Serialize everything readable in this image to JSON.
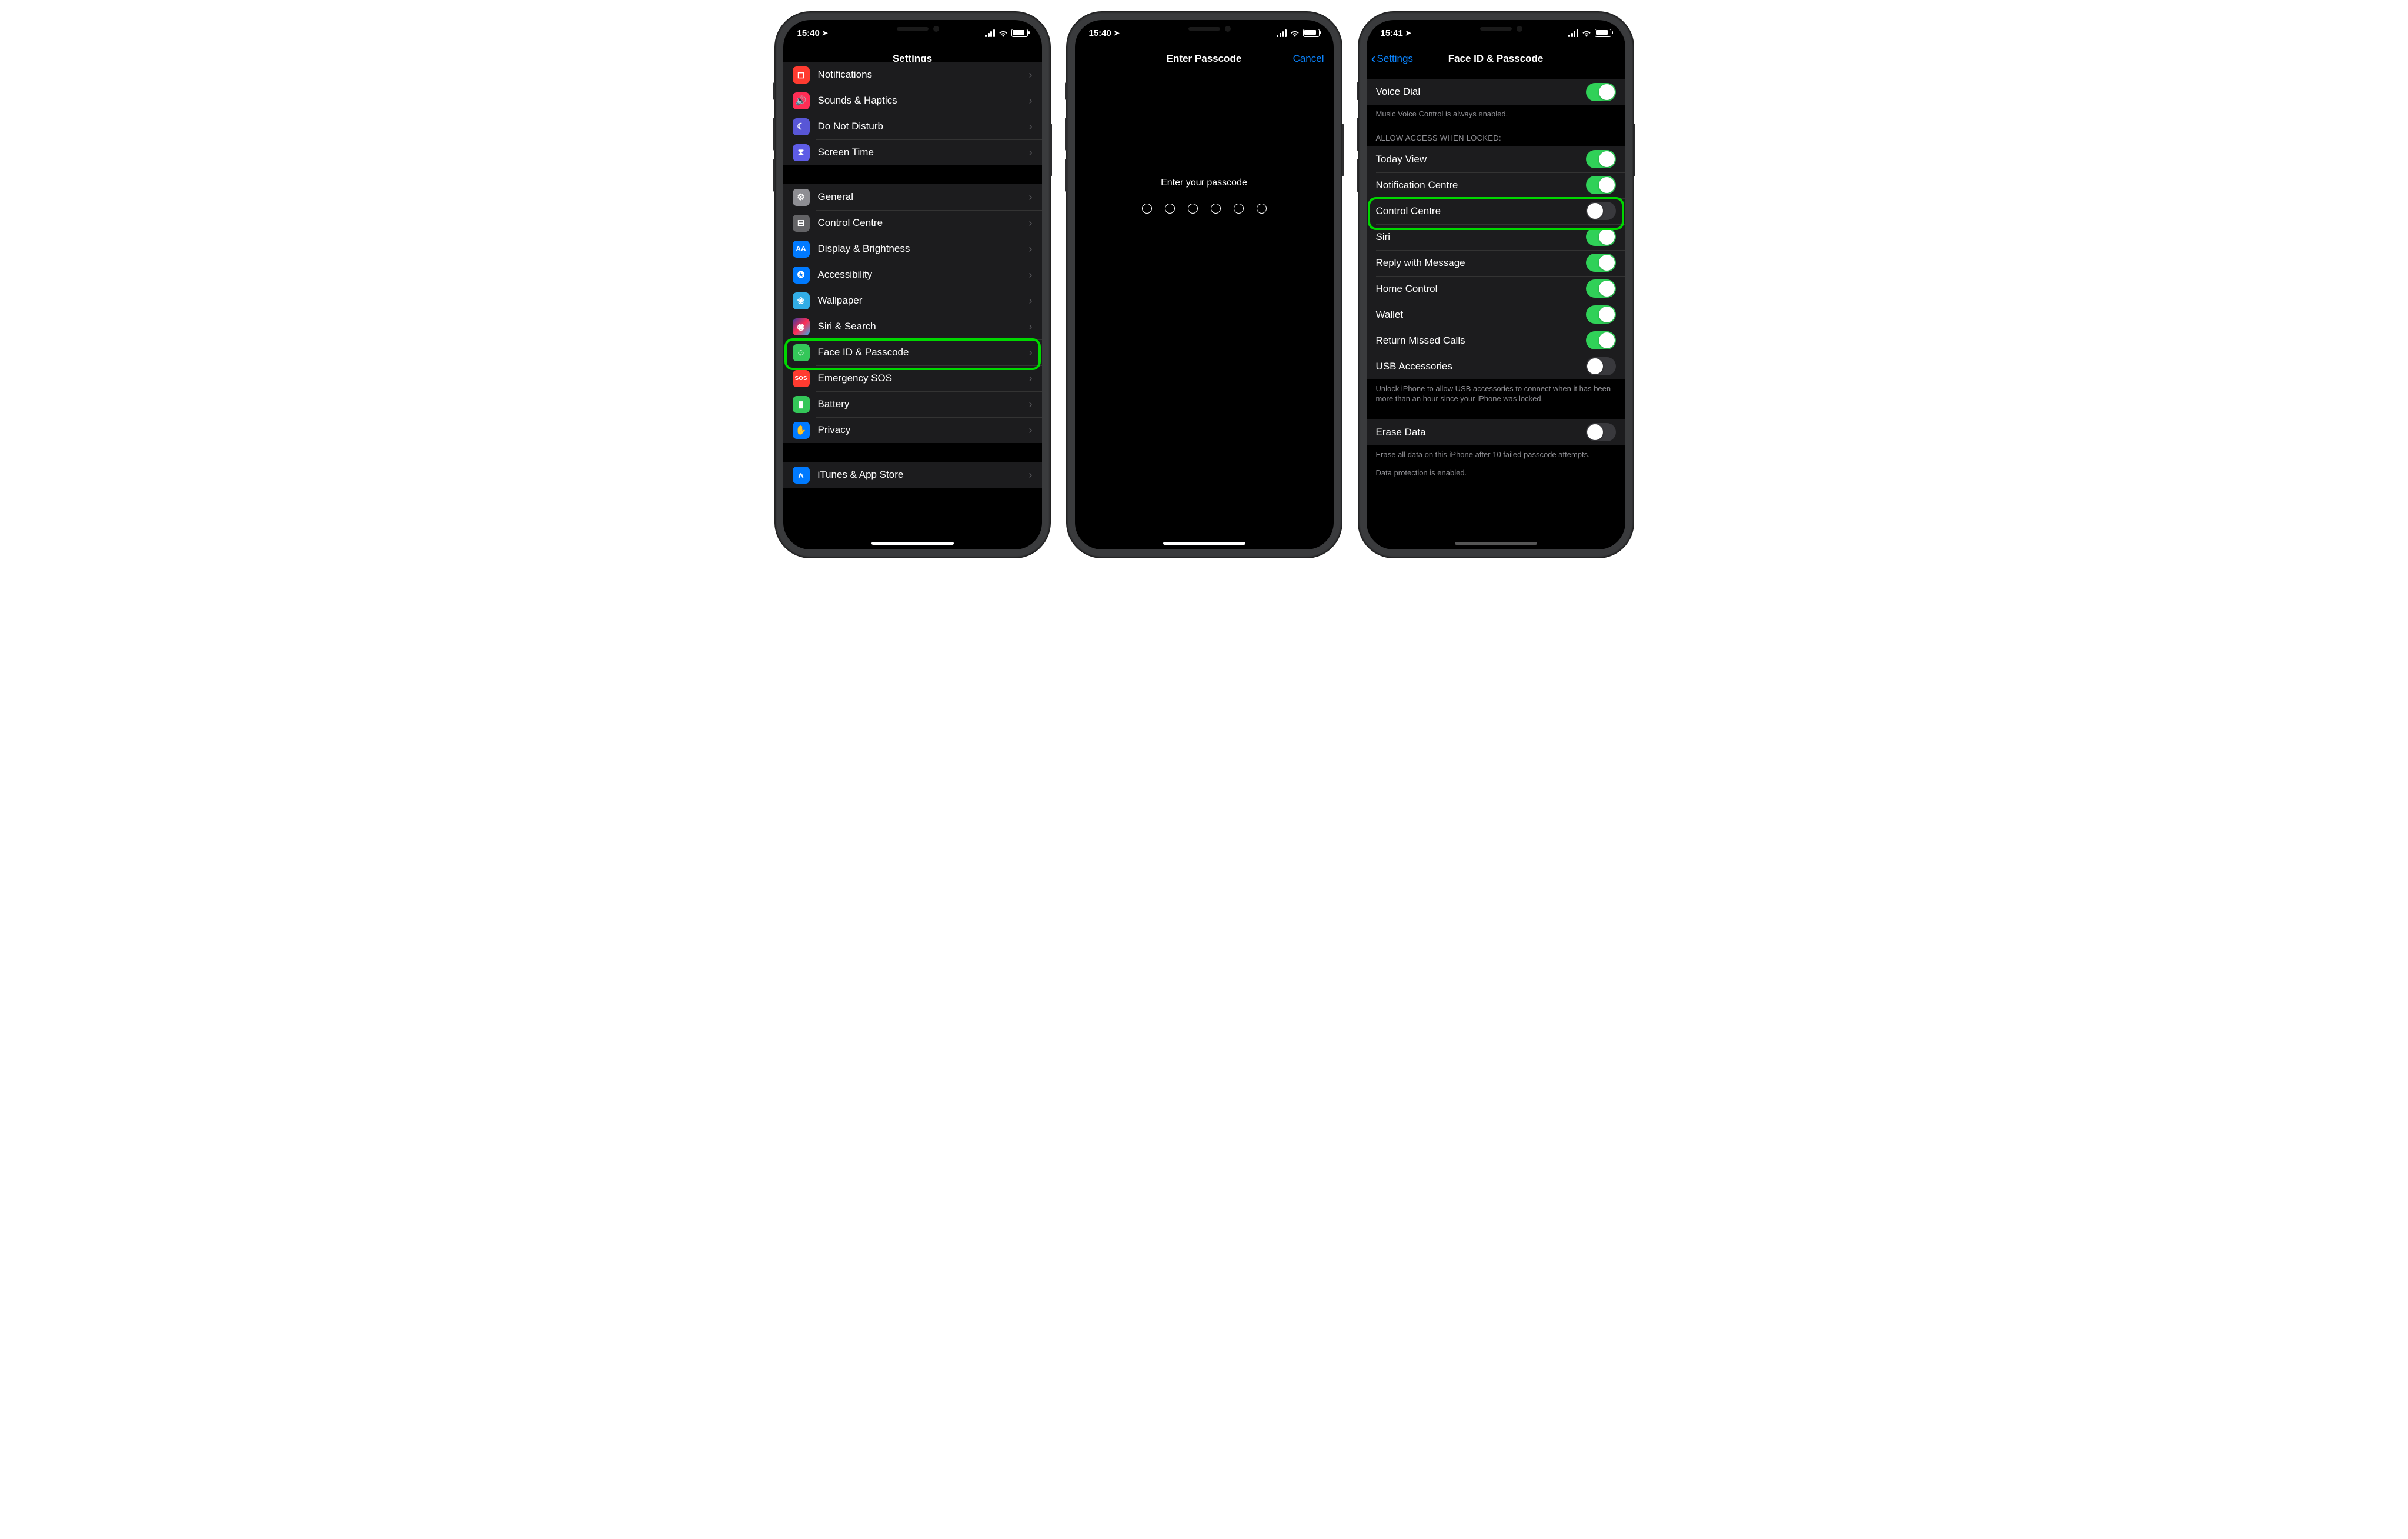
{
  "status": {
    "time": "15:40",
    "time3": "15:41"
  },
  "phone1": {
    "title": "Settings",
    "sectionA": [
      {
        "label": "Notifications"
      },
      {
        "label": "Sounds & Haptics"
      },
      {
        "label": "Do Not Disturb"
      },
      {
        "label": "Screen Time"
      }
    ],
    "sectionB": [
      {
        "label": "General"
      },
      {
        "label": "Control Centre"
      },
      {
        "label": "Display & Brightness"
      },
      {
        "label": "Accessibility"
      },
      {
        "label": "Wallpaper"
      },
      {
        "label": "Siri & Search"
      },
      {
        "label": "Face ID & Passcode"
      },
      {
        "label": "Emergency SOS"
      },
      {
        "label": "Battery"
      },
      {
        "label": "Privacy"
      }
    ],
    "sectionC": [
      {
        "label": "iTunes & App Store"
      }
    ]
  },
  "phone2": {
    "title": "Enter Passcode",
    "cancel": "Cancel",
    "prompt": "Enter your passcode"
  },
  "phone3": {
    "back": "Settings",
    "title": "Face ID & Passcode",
    "voiceDial": "Voice Dial",
    "voiceDialFooter": "Music Voice Control is always enabled.",
    "allowHeader": "Allow access when locked:",
    "allow": [
      {
        "label": "Today View",
        "on": true
      },
      {
        "label": "Notification Centre",
        "on": true
      },
      {
        "label": "Control Centre",
        "on": false
      },
      {
        "label": "Siri",
        "on": true
      },
      {
        "label": "Reply with Message",
        "on": true
      },
      {
        "label": "Home Control",
        "on": true
      },
      {
        "label": "Wallet",
        "on": true
      },
      {
        "label": "Return Missed Calls",
        "on": true
      },
      {
        "label": "USB Accessories",
        "on": false
      }
    ],
    "usbFooter": "Unlock iPhone to allow USB accessories to connect when it has been more than an hour since your iPhone was locked.",
    "eraseLabel": "Erase Data",
    "eraseFooter": "Erase all data on this iPhone after 10 failed passcode attempts.",
    "dpFooter": "Data protection is enabled."
  }
}
